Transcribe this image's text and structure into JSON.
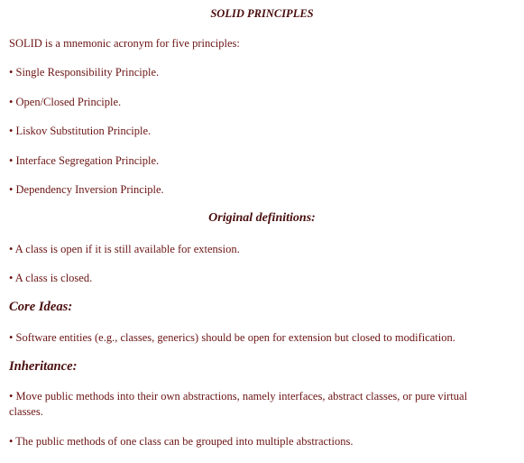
{
  "title": "SOLID PRINCIPLES",
  "intro": "SOLID is a mnemonic acronym for five principles:",
  "principles": [
    "• Single Responsibility Principle.",
    "• Open/Closed Principle.",
    "• Liskov Substitution Principle.",
    "• Interface Segregation Principle.",
    "• Dependency Inversion Principle."
  ],
  "definitions_title": "Original definitions:",
  "definitions": [
    "• A class is open if it is still available for extension.",
    "• A class is closed."
  ],
  "core_ideas_heading": "Core Ideas:",
  "core_ideas": [
    "• Software entities (e.g., classes, generics) should be open for extension but closed to modification."
  ],
  "inheritance_heading": "Inheritance:",
  "inheritance": [
    "• Move public methods into their own abstractions, namely interfaces, abstract classes, or pure virtual classes.",
    "• The public methods of one class can be grouped into multiple abstractions."
  ]
}
